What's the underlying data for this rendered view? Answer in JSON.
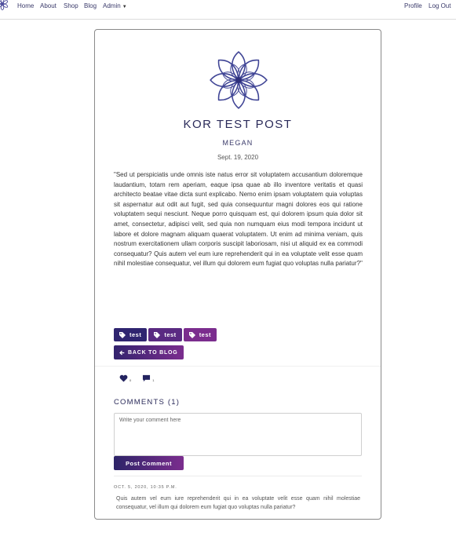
{
  "nav": {
    "links": [
      "Home",
      "About",
      "Shop",
      "Blog"
    ],
    "admin_label": "Admin",
    "right_links": [
      "Profile",
      "Log Out"
    ]
  },
  "post": {
    "title": "KOR TEST POST",
    "author": "MEGAN",
    "date": "Sept. 19, 2020",
    "body": "\"Sed ut perspiciatis unde omnis iste natus error sit voluptatem accusantium doloremque laudantium, totam rem aperiam, eaque ipsa quae ab illo inventore veritatis et quasi architecto beatae vitae dicta sunt explicabo. Nemo enim ipsam voluptatem quia voluptas sit aspernatur aut odit aut fugit, sed quia consequuntur magni dolores eos qui ratione voluptatem sequi nesciunt. Neque porro quisquam est, qui dolorem ipsum quia dolor sit amet, consectetur, adipisci velit, sed quia non numquam eius modi tempora incidunt ut labore et dolore magnam aliquam quaerat voluptatem. Ut enim ad minima veniam, quis nostrum exercitationem ullam corporis suscipit laboriosam, nisi ut aliquid ex ea commodi consequatur? Quis autem vel eum iure reprehenderit qui in ea voluptate velit esse quam nihil molestiae consequatur, vel illum qui dolorem eum fugiat quo voluptas nulla pariatur?\"",
    "tags": [
      "test",
      "test",
      "test"
    ],
    "tag_colors": [
      "#2f2570",
      "#5a2a82",
      "#7b2d8e"
    ],
    "back_label": "BACK TO BLOG",
    "likes": "0",
    "comment_count": "1"
  },
  "comments": {
    "heading": "COMMENTS (1)",
    "placeholder": "Write your comment here",
    "submit_label": "Post Comment",
    "items": [
      {
        "meta": "OCT. 5, 2020, 10:35 P.M.",
        "text": "Quis autem vel eum iure reprehenderit qui in ea voluptate velit esse quam nihil molestiae consequatur, vel illum qui dolorem eum fugiat quo voluptas nulla pariatur?"
      }
    ]
  },
  "theme": {
    "accent": "#3a3b8c",
    "accent_end": "#7b2d8e",
    "heading": "#2b2b5a"
  },
  "icons": [
    "mandala-logo-icon",
    "tag-icon",
    "arrow-left-icon",
    "heart-icon",
    "comment-icon",
    "caret-down-icon"
  ]
}
